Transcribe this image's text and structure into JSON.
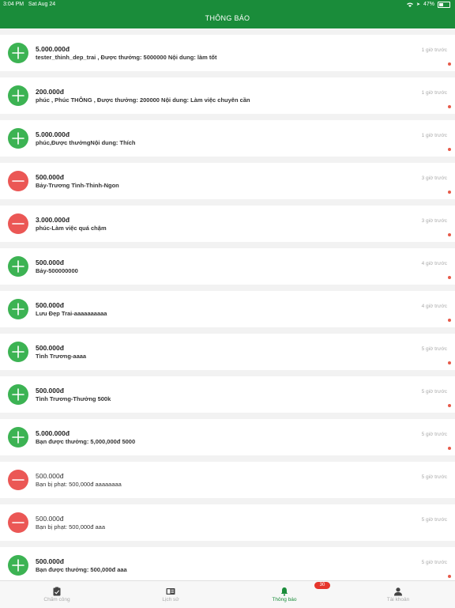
{
  "status_bar": {
    "time": "3:04 PM",
    "date": "Sat Aug 24",
    "battery": "47%"
  },
  "header": {
    "title": "THÔNG BÁO"
  },
  "notifications": [
    {
      "type": "plus",
      "amount": "5.000.000đ",
      "desc": "tester_thinh_dep_trai , Được thưởng: 5000000 Nội dung: làm tốt",
      "time": "1 giờ trước",
      "unread": true
    },
    {
      "type": "plus",
      "amount": "200.000đ",
      "desc": "phúc , Phúc THÔNG , Được thưởng: 200000 Nội dung: Làm việc chuyên cần",
      "time": "1 giờ trước",
      "unread": true
    },
    {
      "type": "plus",
      "amount": "5.000.000đ",
      "desc": "phúc,Được thưởngNội dung: Thích",
      "time": "1 giờ trước",
      "unread": true
    },
    {
      "type": "minus",
      "amount": "500.000đ",
      "desc": "Bảy-Trương Tình-Thinh-Ngon",
      "time": "3 giờ trước",
      "unread": true
    },
    {
      "type": "minus",
      "amount": "3.000.000đ",
      "desc": "phúc-Làm việc quá chậm",
      "time": "3 giờ trước",
      "unread": true
    },
    {
      "type": "plus",
      "amount": "500.000đ",
      "desc": "Bảy-500000000",
      "time": "4 giờ trước",
      "unread": true
    },
    {
      "type": "plus",
      "amount": "500.000đ",
      "desc": "Lưu Đẹp Trai-aaaaaaaaaa",
      "time": "4 giờ trước",
      "unread": true
    },
    {
      "type": "plus",
      "amount": "500.000đ",
      "desc": "Tình Trương-aaaa",
      "time": "5 giờ trước",
      "unread": true
    },
    {
      "type": "plus",
      "amount": "500.000đ",
      "desc": "Tình Trương-Thưởng 500k",
      "time": "5 giờ trước",
      "unread": true
    },
    {
      "type": "plus",
      "amount": "5.000.000đ",
      "desc": "Bạn được thưởng: 5,000,000đ 5000",
      "time": "5 giờ trước",
      "unread": true
    },
    {
      "type": "minus",
      "amount": "500.000đ",
      "desc": "Bạn bị phạt: 500,000đ aaaaaaaa",
      "time": "5 giờ trước",
      "unread": false
    },
    {
      "type": "minus",
      "amount": "500.000đ",
      "desc": "Bạn bị phạt: 500,000đ aaa",
      "time": "5 giờ trước",
      "unread": false
    },
    {
      "type": "plus",
      "amount": "500.000đ",
      "desc": "Bạn được thưởng: 500,000đ aaa",
      "time": "5 giờ trước",
      "unread": true
    }
  ],
  "tabs": [
    {
      "label": "Chấm công",
      "icon": "clipboard-check-icon",
      "active": false
    },
    {
      "label": "Lịch sử",
      "icon": "history-book-icon",
      "active": false
    },
    {
      "label": "Thông báo",
      "icon": "bell-icon",
      "active": true
    },
    {
      "label": "Tài khoản",
      "icon": "user-icon",
      "active": false
    }
  ],
  "badge": {
    "count": "30"
  },
  "colors": {
    "header": "#1a8c3a",
    "plus": "#3cb353",
    "minus": "#eb5755",
    "dot": "#e65a4a",
    "badge": "#e5352b"
  }
}
